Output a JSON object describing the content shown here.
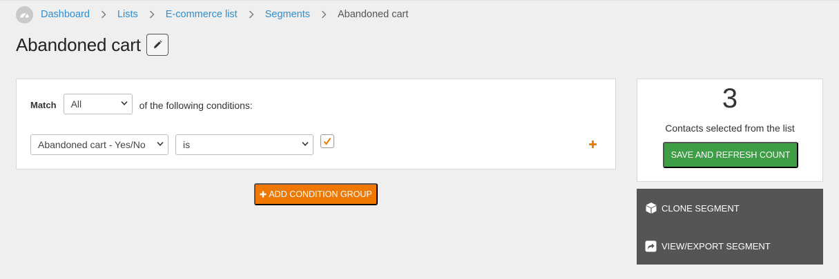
{
  "breadcrumb": {
    "home_icon": "dashboard-gauge-icon",
    "items": [
      {
        "label": "Dashboard"
      },
      {
        "label": "Lists"
      },
      {
        "label": "E-commerce list"
      },
      {
        "label": "Segments"
      }
    ],
    "current": "Abandoned cart"
  },
  "page": {
    "title": "Abandoned cart",
    "edit_icon": "pencil-icon"
  },
  "conditions": {
    "match_label": "Match",
    "match_value": "All",
    "match_suffix": "of the following conditions:",
    "rows": [
      {
        "field": "Abandoned cart - Yes/No",
        "operator": "is",
        "checked": true
      }
    ],
    "add_condition_icon": "plus-icon"
  },
  "add_group_button": {
    "label": "ADD CONDITION GROUP",
    "icon": "plus-icon"
  },
  "count": {
    "value": "3",
    "label": "Contacts selected from the list",
    "save_button": "SAVE AND REFRESH COUNT"
  },
  "actions": {
    "clone": {
      "label": "CLONE SEGMENT",
      "icon": "cube-icon"
    },
    "export": {
      "label": "VIEW/EXPORT SEGMENT",
      "icon": "share-icon"
    }
  },
  "colors": {
    "link": "#2b8fd8",
    "accent_orange": "#f07800",
    "save_green": "#3e9e45",
    "actions_bg": "#555555",
    "page_bg": "#efefef"
  }
}
